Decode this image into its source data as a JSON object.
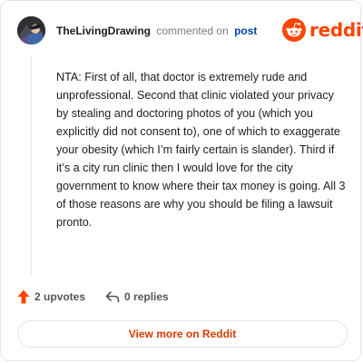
{
  "header": {
    "username": "TheLivingDrawing",
    "action": "commented on",
    "post_link": "post",
    "brand": "reddit"
  },
  "comment": {
    "text": "NTA: First of all, that doctor is extremely rude and unprofessional. Second that clinic violated your privacy by stealing and doctoring photos of you (which you explicitly did not consent to), one of which to exaggerate your obesity (which I’m fairly certain is slander). Third if it’s a city run clinic then I would love for the city government to know where their tax money is going. All 3 of those reasons are why you should be filing a lawsuit pronto."
  },
  "footer": {
    "upvotes": "2 upvotes",
    "replies": "0 replies"
  },
  "cta": {
    "label": "View more on Reddit"
  },
  "icons": {
    "avatar": "avatar-icon",
    "brand": "reddit-logo-icon",
    "upvote": "upvote-arrow-icon",
    "reply": "reply-arrow-icon"
  },
  "colors": {
    "accent": "#ff4500",
    "link": "#0045ac",
    "cta_text": "#d93a00"
  }
}
